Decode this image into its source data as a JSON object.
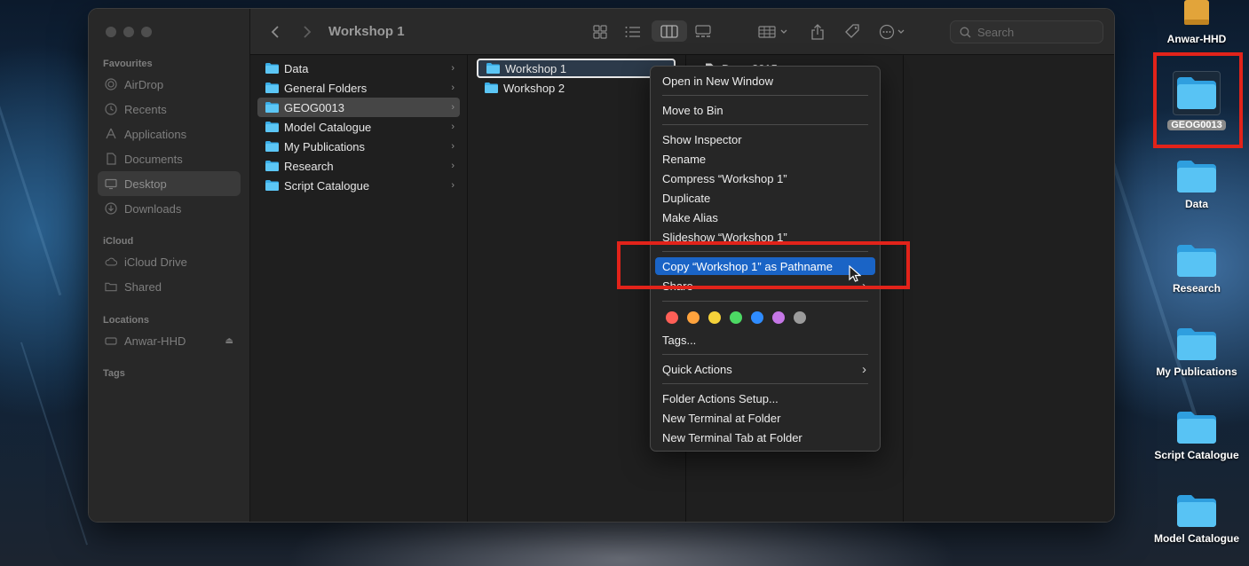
{
  "finder": {
    "sidebar": {
      "sections": {
        "favourites": "Favourites",
        "icloud": "iCloud",
        "locations": "Locations",
        "tags": "Tags"
      },
      "favourites": [
        "AirDrop",
        "Recents",
        "Applications",
        "Documents",
        "Desktop",
        "Downloads"
      ],
      "icloud_items": [
        "iCloud Drive",
        "Shared"
      ],
      "location_items": [
        "Anwar-HHD"
      ]
    },
    "toolbar": {
      "title": "Workshop 1",
      "search_placeholder": "Search"
    },
    "columns": {
      "first": [
        "Data",
        "General Folders",
        "GEOG0013",
        "Model Catalogue",
        "My Publications",
        "Research",
        "Script Catalogue"
      ],
      "second": [
        "Workshop 1",
        "Workshop 2"
      ],
      "third_partial": "Docu           2015"
    }
  },
  "context_menu": {
    "items": {
      "open_new_window": "Open in New Window",
      "move_to_bin": "Move to Bin",
      "show_inspector": "Show Inspector",
      "rename": "Rename",
      "compress": "Compress “Workshop 1”",
      "duplicate": "Duplicate",
      "make_alias": "Make Alias",
      "slideshow": "Slideshow “Workshop 1”",
      "copy_pathname": "Copy “Workshop 1” as Pathname",
      "share": "Share",
      "tags": "Tags...",
      "quick_actions": "Quick Actions",
      "folder_actions": "Folder Actions Setup...",
      "new_terminal": "New Terminal at Folder",
      "new_terminal_tab": "New Terminal Tab at Folder"
    },
    "tag_colors": [
      "#ff5f57",
      "#ffa33d",
      "#f5d23a",
      "#4cd964",
      "#2f8cff",
      "#c577e6",
      "#9b9b9b"
    ],
    "highlight_color": "#1a64c6"
  },
  "desktop": {
    "items": [
      "Anwar-HHD",
      "GEOG0013",
      "Data",
      "Research",
      "My Publications",
      "Script Catalogue",
      "Model Catalogue"
    ]
  },
  "annotation_color": "#e2231a"
}
